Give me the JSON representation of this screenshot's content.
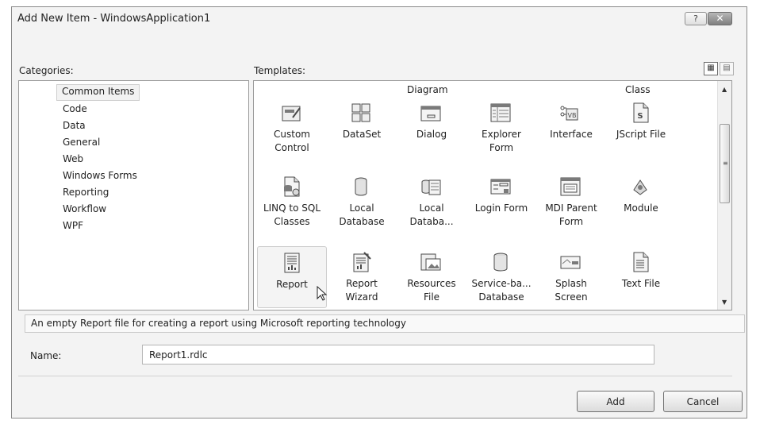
{
  "dialog": {
    "title": "Add New Item - WindowsApplication1",
    "help_label": "?",
    "close_label": "✕"
  },
  "categories": {
    "label": "Categories:",
    "items": [
      "Common Items",
      "Code",
      "Data",
      "General",
      "Web",
      "Windows Forms",
      "Reporting",
      "Workflow",
      "WPF"
    ],
    "selected": "Common Items"
  },
  "templates": {
    "label": "Templates:",
    "view_large_icon": "large-icons-view-icon",
    "view_small_icon": "small-icons-view-icon",
    "view_large_glyph": "▦",
    "view_small_glyph": "▤",
    "header_row": [
      "Diagram",
      "Class"
    ],
    "items": [
      {
        "label": "Custom\nControl",
        "icon": "custom-control-icon"
      },
      {
        "label": "DataSet",
        "icon": "dataset-icon"
      },
      {
        "label": "Dialog",
        "icon": "dialog-icon"
      },
      {
        "label": "Explorer\nForm",
        "icon": "explorer-form-icon"
      },
      {
        "label": "Interface",
        "icon": "interface-icon"
      },
      {
        "label": "JScript File",
        "icon": "jscript-file-icon"
      },
      {
        "label": "LINQ to SQL\nClasses",
        "icon": "linq-to-sql-icon"
      },
      {
        "label": "Local\nDatabase",
        "icon": "local-database-icon"
      },
      {
        "label": "Local\nDataba...",
        "icon": "local-database-cache-icon"
      },
      {
        "label": "Login Form",
        "icon": "login-form-icon"
      },
      {
        "label": "MDI Parent\nForm",
        "icon": "mdi-parent-form-icon"
      },
      {
        "label": "Module",
        "icon": "module-icon"
      },
      {
        "label": "Report",
        "icon": "report-icon",
        "selected": true
      },
      {
        "label": "Report\nWizard",
        "icon": "report-wizard-icon"
      },
      {
        "label": "Resources\nFile",
        "icon": "resources-file-icon"
      },
      {
        "label": "Service-ba...\nDatabase",
        "icon": "service-based-database-icon"
      },
      {
        "label": "Splash\nScreen",
        "icon": "splash-screen-icon"
      },
      {
        "label": "Text File",
        "icon": "text-file-icon"
      }
    ],
    "scroll": {
      "up": "▲",
      "down": "▼",
      "grip": "≡"
    }
  },
  "description": "An empty Report file for creating a report using Microsoft reporting technology",
  "name_field": {
    "label": "Name:",
    "value": "Report1.rdlc"
  },
  "buttons": {
    "add": "Add",
    "cancel": "Cancel"
  }
}
